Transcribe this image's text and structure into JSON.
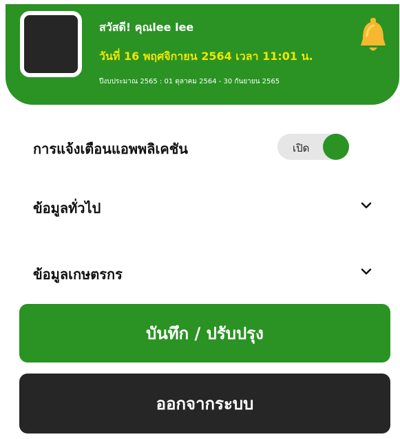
{
  "header": {
    "greeting": "สวัสดี! คุณlee lee",
    "datetime": "วันที่ 16 พฤศจิกายน 2564 เวลา 11:01 น.",
    "fiscal_year": "ปีงบประมาณ 2565 : 01 ตุลาคม 2564 - 30 กันยายน 2565",
    "bell_icon": "bell-icon"
  },
  "settings": {
    "notification_label": "การแจ้งเตือนแอพพลิเคชัน",
    "notification_toggle_text": "เปิด",
    "notification_enabled": true,
    "general_info_label": "ข้อมูลทั่วไป",
    "farmer_info_label": "ข้อมูลเกษตรกร"
  },
  "buttons": {
    "save_label": "บันทึก / ปรับปรุง",
    "logout_label": "ออกจากระบบ"
  },
  "colors": {
    "primary_green": "#2a9323",
    "highlight_yellow": "#f2e600",
    "dark": "#262626",
    "bell": "#f5b82e"
  }
}
